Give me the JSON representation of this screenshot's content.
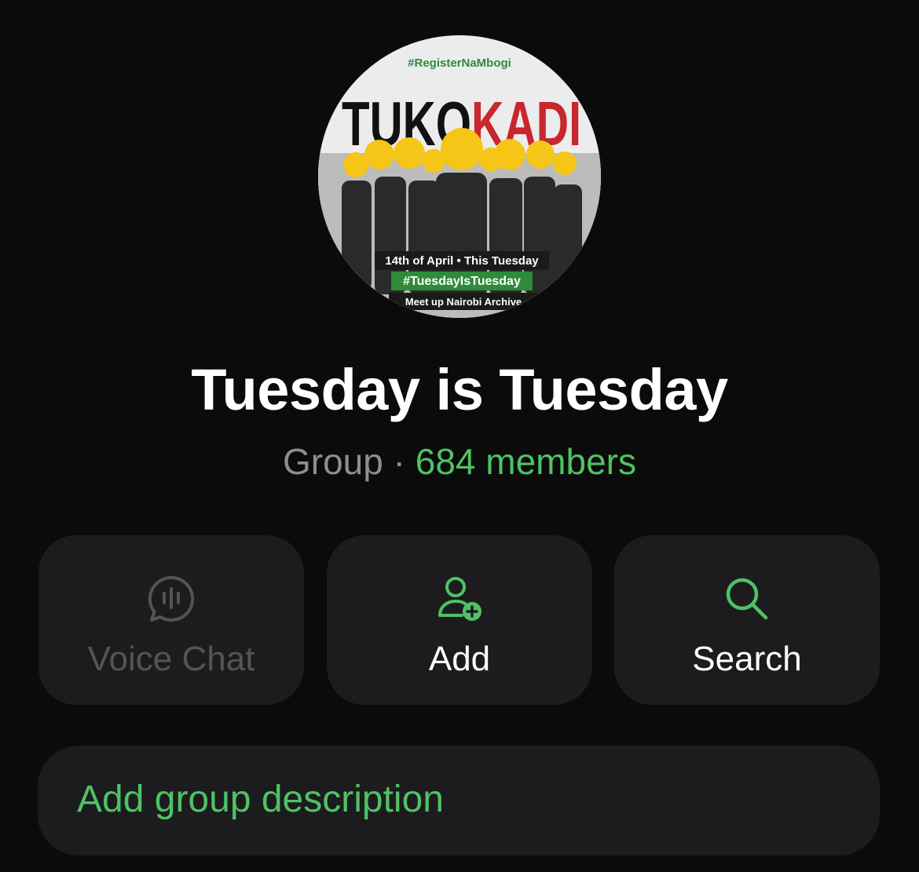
{
  "group": {
    "title": "Tuesday is Tuesday",
    "type": "Group",
    "separator": " · ",
    "members": "684 members"
  },
  "avatar": {
    "hashtag_top": "#RegisterNaMbogi",
    "headline_left": "TUKO",
    "headline_right": "KADI",
    "line_date": "14th of April • This Tuesday",
    "line_hashtag": "#TuesdayIsTuesday",
    "line_meetup": "Meet up Nairobi Archive"
  },
  "actions": [
    {
      "label": "Voice Chat",
      "icon": "voice-chat-icon",
      "enabled": false
    },
    {
      "label": "Add",
      "icon": "add-member-icon",
      "enabled": true
    },
    {
      "label": "Search",
      "icon": "search-icon",
      "enabled": true
    }
  ],
  "description": {
    "label": "Add group description"
  },
  "colors": {
    "background": "#0b0b0b",
    "card": "#1c1c1e",
    "accent": "#4fc265",
    "secondary_text": "#8d8d92",
    "disabled_text": "#545458"
  }
}
